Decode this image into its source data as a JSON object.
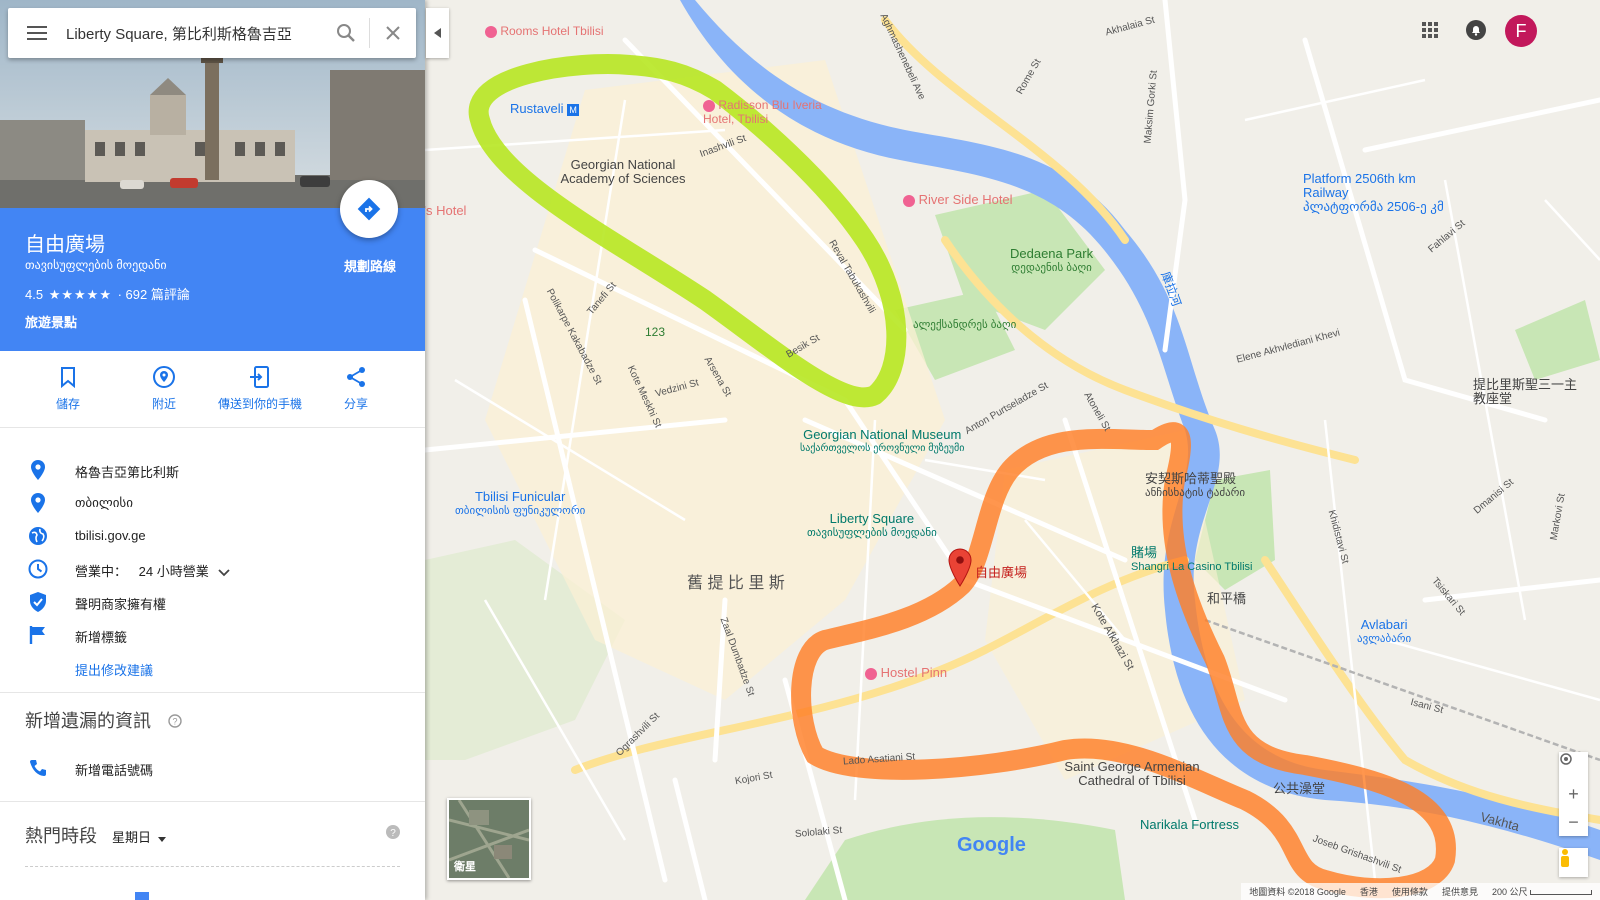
{
  "search": {
    "query": "Liberty Square, 第比利斯格魯吉亞"
  },
  "place": {
    "name": "自由廣場",
    "name_local": "თავისუფლების მოედანი",
    "rating": "4.5",
    "stars": "★★★★★",
    "reviews": "· 692 篇評論",
    "category": "旅遊景點",
    "directions_label": "規劃路線"
  },
  "actions": [
    {
      "label": "儲存",
      "icon": "bookmark-icon"
    },
    {
      "label": "附近",
      "icon": "nearby-icon"
    },
    {
      "label": "傳送到你的手機",
      "icon": "send-to-phone-icon"
    },
    {
      "label": "分享",
      "icon": "share-icon"
    }
  ],
  "info": {
    "address": "格魯吉亞第比利斯",
    "locality": "თბილისი",
    "website": "tbilisi.gov.ge",
    "hours_status": "營業中：",
    "hours_value": "24 小時營業",
    "claim": "聲明商家擁有權",
    "add_label": "新增標籤",
    "suggest_edit": "提出修改建議"
  },
  "missing_info": {
    "title": "新增遺漏的資訊",
    "add_phone": "新增電話號碼"
  },
  "popular_times": {
    "title": "熱門時段",
    "day": "星期日"
  },
  "map": {
    "labels": {
      "rooms_hotel": "Rooms Hotel Tbilisi",
      "radisson": "Radisson Blu Iveria Hotel, Tbilisi",
      "rustaveli": "Rustaveli",
      "academy": "Georgian National Academy of Sciences",
      "rys_hotel": "y's Hotel",
      "riverside": "River Side Hotel",
      "dedaena": "Dedaena Park",
      "dedaena_ka": "დედაენის ბაღი",
      "alexander": "ალექსანდრეს ბაღი",
      "platform": "Platform 2506th km Railway",
      "platform_ka": "პლატფორმა 2506-ე კმ",
      "kura": "庫拉河",
      "trinity": "提比里斯聖三一主教座堂",
      "museum": "Georgian National Museum",
      "museum_ka": "საქართველოს ეროვნული მუზეუმი",
      "funicular": "Tbilisi Funicular",
      "funicular_ka": "თბილისის ფუნიკულორი",
      "liberty": "Liberty Square",
      "liberty_ka": "თავისუფლების მოედანი",
      "old_tbilisi": "舊 提 比 里 斯",
      "marker": "自由廣場",
      "anchiskhati": "安契斯哈蒂聖殿",
      "anchiskhati_ka": "ანჩისხატის ტაძარი",
      "casino": "賭場",
      "casino_en": "Shangri La Casino Tbilisi",
      "peace_bridge": "和平橋",
      "avlabari": "Avlabari",
      "avlabari_ka": "ავლაბარი",
      "hostel": "Hostel Pinn",
      "st_george": "Saint George Armenian Cathedral of Tbilisi",
      "bath": "公共澡堂",
      "narikala": "Narikala Fortress",
      "vakhtang": "Vakhta",
      "n123": "123",
      "google": "Google",
      "satellite": "衛星"
    },
    "streets": [
      "Aghmashenebeli Ave",
      "Rome St",
      "Maksim Gorki St",
      "Akhalaia St",
      "Inashvili St",
      "Polikarpe Kakabadze St",
      "Besik St",
      "Reval Tabukashvili",
      "Arsena St",
      "Vedzini St",
      "Kote Meskhi St",
      "Anton Purtseladze St",
      "Atoneli St",
      "Tanefi St",
      "Elene Akhvlediani Khevi",
      "Dmanisi St",
      "Zaal Dumbadze St",
      "Ograshvili St",
      "Kojori St",
      "Lado Asatiani St",
      "Sololaki St",
      "Kote Afkhazi St",
      "Isani St",
      "Tsiskari St",
      "Fahlavi St",
      "Khidistavi St",
      "Markovi St",
      "Joseb Grishashvili St"
    ],
    "footer": [
      "地圖資料 ©2018 Google",
      "香港",
      "使用條款",
      "提供意見",
      "200 公尺"
    ]
  },
  "colors": {
    "accent": "#4285f4",
    "route_green": "#b5e61d",
    "route_orange": "#ff7f27",
    "river": "#8ab4f8",
    "park": "#c6e8b4"
  }
}
